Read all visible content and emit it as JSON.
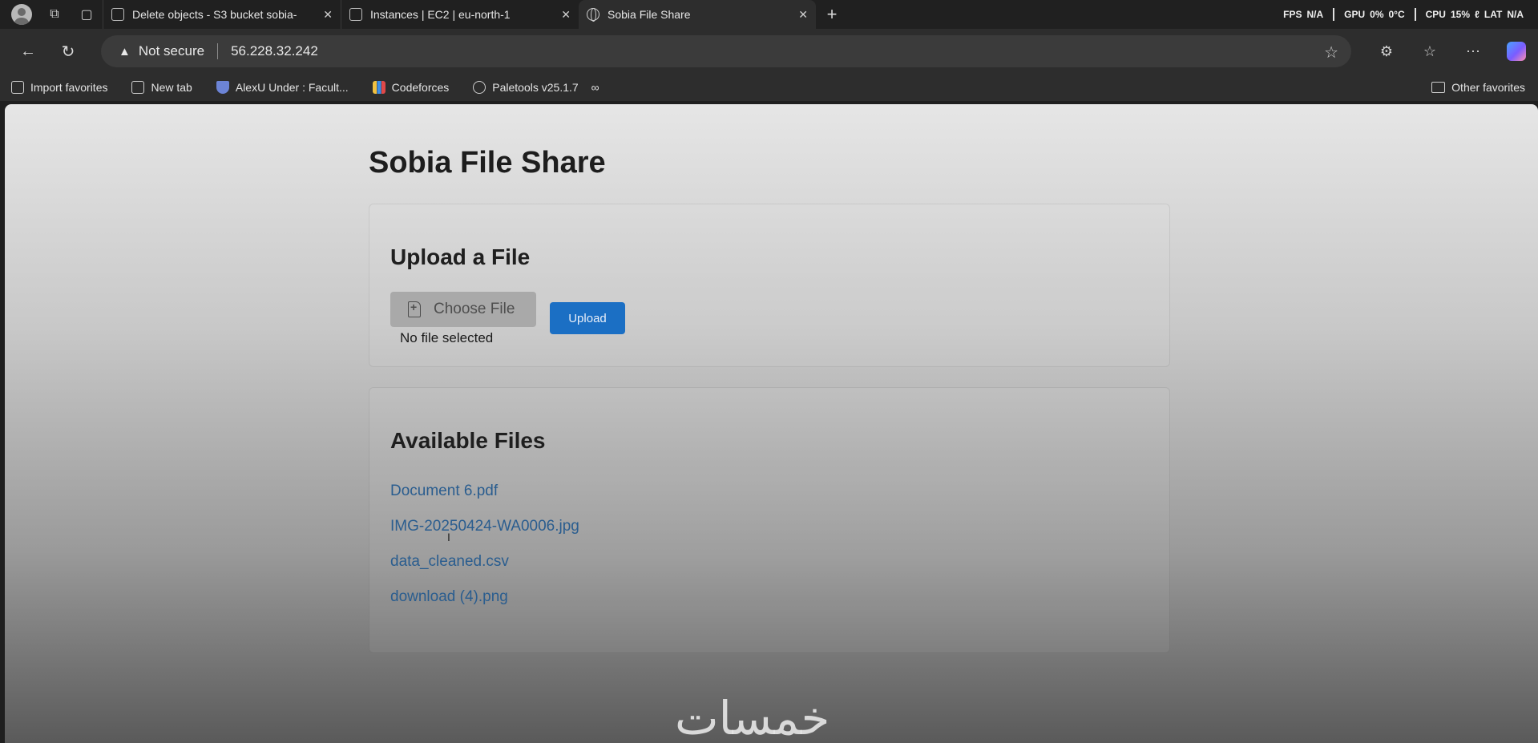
{
  "browser": {
    "tabs": [
      {
        "title": "Delete objects - S3 bucket sobia-",
        "active": false
      },
      {
        "title": "Instances | EC2 | eu-north-1",
        "active": false
      },
      {
        "title": "Sobia File Share",
        "active": true
      }
    ],
    "perf": {
      "fps_label": "FPS",
      "fps_value": "N/A",
      "gpu_label": "GPU",
      "gpu_value": "0%",
      "gpu_temp": "0°C",
      "cpu_label": "CPU",
      "cpu_value": "15%",
      "lat_label": "LAT",
      "lat_value": "N/A"
    },
    "address": {
      "security": "Not secure",
      "url": "56.228.32.242"
    },
    "favorites": [
      {
        "label": "Import favorites",
        "icon": "import-icon"
      },
      {
        "label": "New tab",
        "icon": "newtab-icon"
      },
      {
        "label": "AlexU Under : Facult...",
        "icon": "shield-icon"
      },
      {
        "label": "Codeforces",
        "icon": "codeforces-icon"
      },
      {
        "label": "Paletools v25.1.7",
        "icon": "globe-icon"
      }
    ],
    "other_favorites": "Other favorites"
  },
  "page": {
    "title": "Sobia File Share",
    "upload": {
      "heading": "Upload a File",
      "choose_label": "Choose File",
      "no_file": "No file selected",
      "upload_label": "Upload"
    },
    "files": {
      "heading": "Available Files",
      "items": [
        "Document 6.pdf",
        "IMG-20250424-WA0006.jpg",
        "data_cleaned.csv",
        "download (4).png"
      ]
    }
  },
  "watermark": "خمسات",
  "colors": {
    "upload_button": "#1b6fc4",
    "link": "#2a5d8f"
  }
}
